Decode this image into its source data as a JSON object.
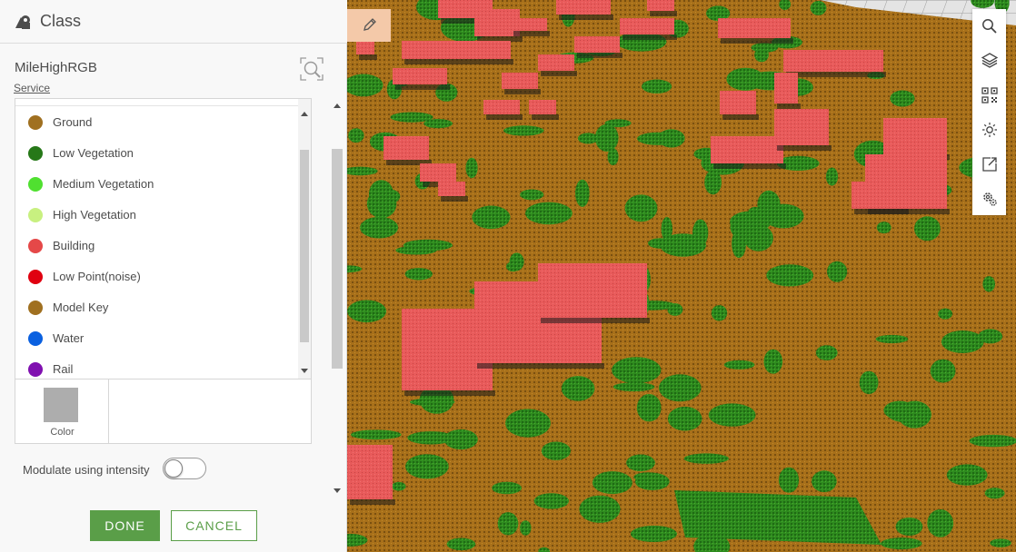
{
  "panel": {
    "title": "Class",
    "title_icon": "class-symbol-icon",
    "layer_name": "MileHighRGB",
    "layer_link": "Service",
    "zoom_icon": "zoom-to-layer-icon"
  },
  "classes": [
    {
      "label": "Ground",
      "color": "#a07020"
    },
    {
      "label": "Low Vegetation",
      "color": "#267818"
    },
    {
      "label": "Medium Vegetation",
      "color": "#50e030"
    },
    {
      "label": "High Vegetation",
      "color": "#c8f080"
    },
    {
      "label": "Building",
      "color": "#e54848"
    },
    {
      "label": "Low Point(noise)",
      "color": "#e00010"
    },
    {
      "label": "Model Key",
      "color": "#a07020"
    },
    {
      "label": "Water",
      "color": "#0a60e0"
    },
    {
      "label": "Rail",
      "color": "#8010b0"
    }
  ],
  "color_picker": {
    "label": "Color",
    "value": "#adadad"
  },
  "modulate": {
    "label": "Modulate using intensity",
    "enabled": false
  },
  "buttons": {
    "done": "DONE",
    "cancel": "CANCEL"
  },
  "toolbar": [
    {
      "name": "search-icon"
    },
    {
      "name": "layers-icon"
    },
    {
      "name": "qr-code-icon"
    },
    {
      "name": "daylight-icon"
    },
    {
      "name": "share-icon"
    },
    {
      "name": "settings-icon"
    }
  ],
  "colors": {
    "accent": "#5a9e48",
    "ground": "#a8701a",
    "vegetation": "#2e8a1e",
    "building": "#e85a5a"
  }
}
